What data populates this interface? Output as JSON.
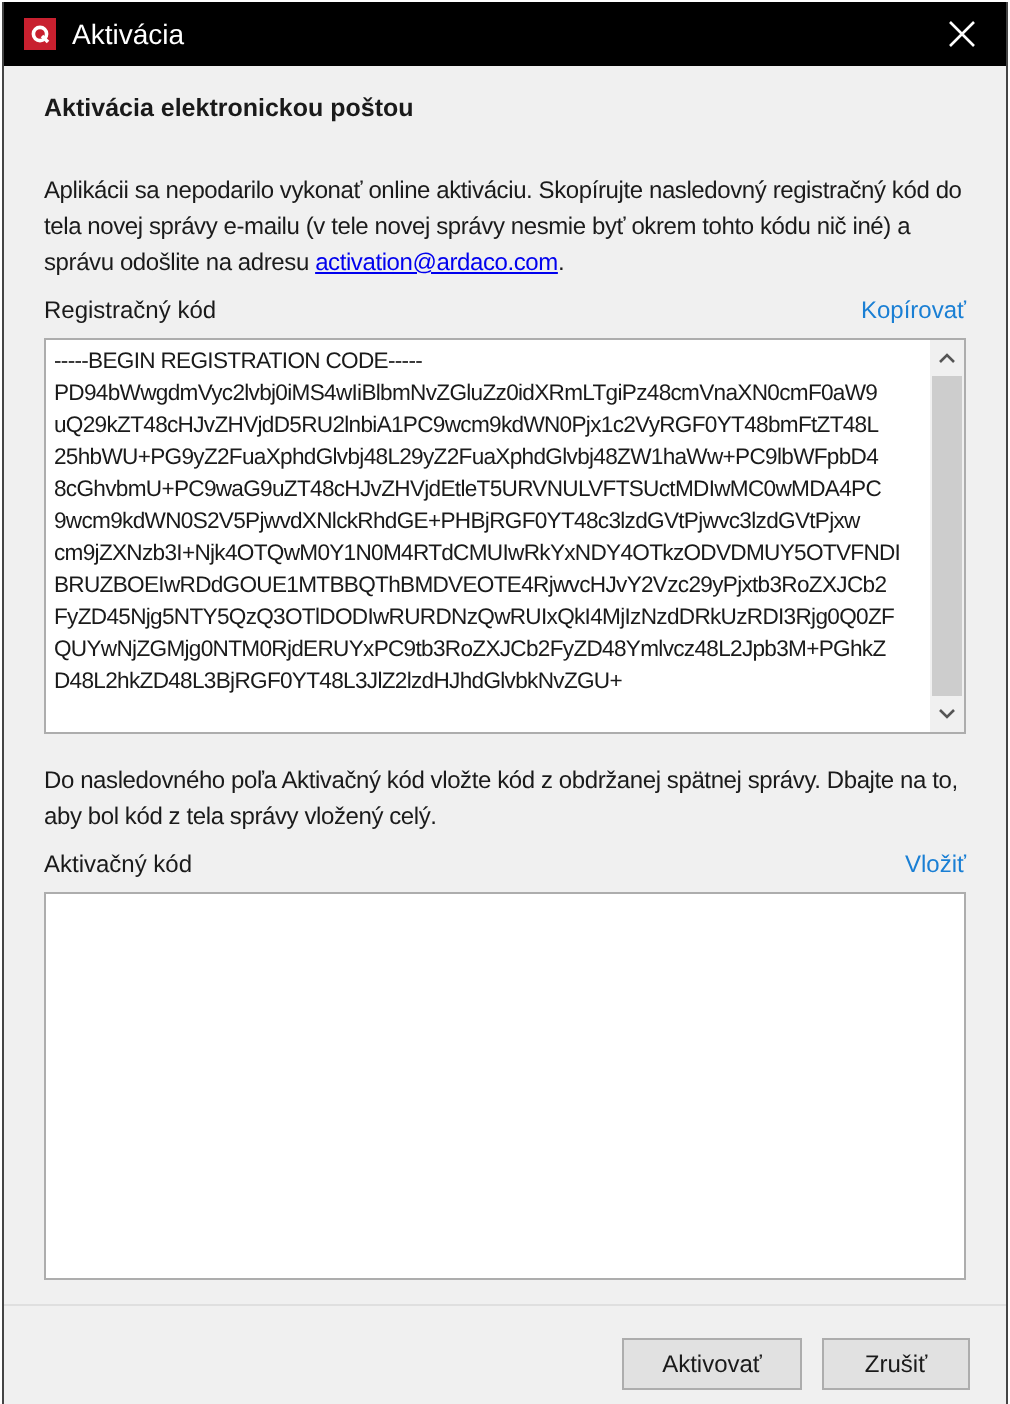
{
  "window": {
    "title": "Aktivácia"
  },
  "heading": "Aktivácia elektronickou poštou",
  "intro": {
    "text": "Aplikácii sa nepodarilo vykonať online aktiváciu. Skopírujte nasledovný registračný kód do tela novej správy e-mailu (v tele novej správy nesmie byť okrem tohto kódu nič iné) a správu odošlite na adresu",
    "link": "activation@ardaco.com",
    "end": "."
  },
  "registration": {
    "label": "Registračný kód",
    "action": "Kopírovať",
    "lines": [
      "-----BEGIN REGISTRATION CODE-----",
      "PD94bWwgdmVyc2lvbj0iMS4wIiBlbmNvZGluZz0idXRmLTgiPz48cmVnaXN0cmF0aW9",
      "uQ29kZT48cHJvZHVjdD5RU2lnbiA1PC9wcm9kdWN0Pjx1c2VyRGF0YT48bmFtZT48L",
      "25hbWU+PG9yZ2FuaXphdGlvbj48L29yZ2FuaXphdGlvbj48ZW1haWw+PC9lbWFpbD4",
      "8cGhvbmU+PC9waG9uZT48cHJvZHVjdEtleT5URVNULVFTSUctMDIwMC0wMDA4PC",
      "9wcm9kdWN0S2V5PjwvdXNlckRhdGE+PHBjRGF0YT48c3lzdGVtPjwvc3lzdGVtPjxw",
      "cm9jZXNzb3I+Njk4OTQwM0Y1N0M4RTdCMUIwRkYxNDY4OTkzODVDMUY5OTVFNDI",
      "BRUZBOEIwRDdGOUE1MTBBQThBMDVEOTE4RjwvcHJvY2Vzc29yPjxtb3RoZXJCb2",
      "FyZD45Njg5NTY5QzQ3OTlDODIwRURDNzQwRUIxQkI4MjIzNzdDRkUzRDI3Rjg0Q0ZF",
      "QUYwNjZGMjg0NTM0RjdERUYxPC9tb3RoZXJCb2FyZD48Ymlvcz48L2Jpb3M+PGhkZ",
      "D48L2hkZD48L3BjRGF0YT48L3JlZ2lzdHJhdGlvbkNvZGU+"
    ]
  },
  "instruction": "Do nasledovného poľa Aktivačný kód vložte kód z obdržanej spätnej správy. Dbajte na to, aby bol kód z tela správy vložený celý.",
  "activation": {
    "label": "Aktivačný kód",
    "action": "Vložiť"
  },
  "buttons": [
    "Aktivovať",
    "Zrušiť"
  ]
}
